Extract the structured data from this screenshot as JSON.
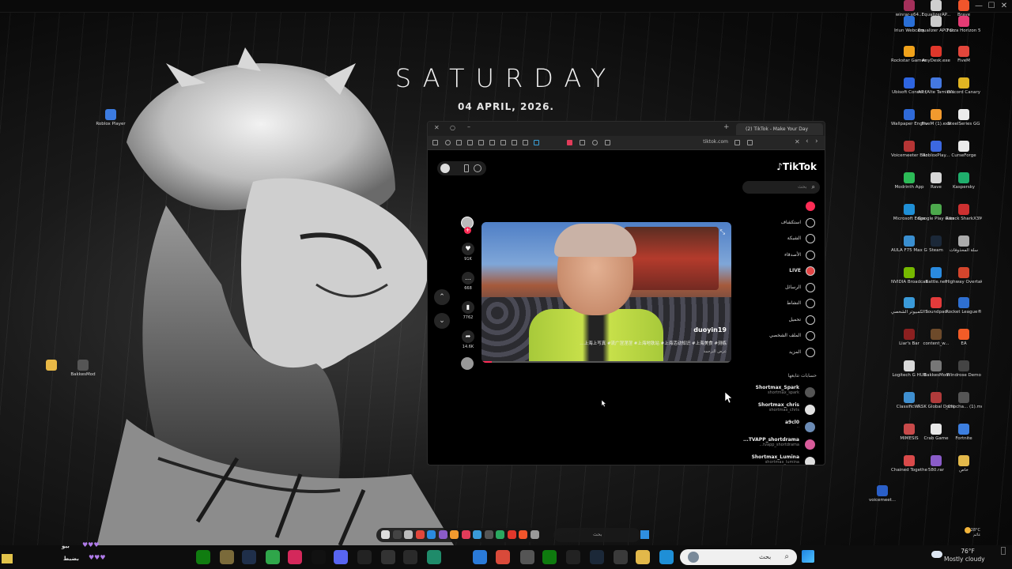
{
  "desktop": {
    "day": "SATURDAY",
    "date": "04 APRIL, 2026.",
    "left_icons": [
      {
        "label": "Roblox Player",
        "color": "#3c7be0"
      },
      {
        "label": "BakkesMod",
        "color": "#555555"
      }
    ],
    "right_icons": [
      {
        "label": "Iriun Webcam",
        "color": "#2a6fd6"
      },
      {
        "label": "Equalizer APO Confi...",
        "color": "#c9c9c9"
      },
      {
        "label": "Forza Horizon 5",
        "color": "#e53b74"
      },
      {
        "label": "Rockstar Games ...",
        "color": "#f0a21b"
      },
      {
        "label": "AnyDesk.exe",
        "color": "#e0372b"
      },
      {
        "label": "FiveM",
        "color": "#e2463b"
      },
      {
        "label": "Ubisoft Connect",
        "color": "#2e65e0"
      },
      {
        "label": "A7 (Alte Tamim’th...",
        "color": "#4478e0"
      },
      {
        "label": "Discord Canary",
        "color": "#e0b422"
      },
      {
        "label": "Wallpaper Engine",
        "color": "#2f6ad8"
      },
      {
        "label": "FiveM (1).exe",
        "color": "#f29a2e"
      },
      {
        "label": "SteelSeries GG",
        "color": "#ececec"
      },
      {
        "label": "Voicemeeter Banana",
        "color": "#b53535"
      },
      {
        "label": "RobloxPlay...",
        "color": "#3c68e0"
      },
      {
        "label": "CurseForge",
        "color": "#eaeaea"
      },
      {
        "label": "Modrinth App",
        "color": "#2cbb57"
      },
      {
        "label": "Rave",
        "color": "#d7d7d7"
      },
      {
        "label": "Kaspersky",
        "color": "#1fae6c"
      },
      {
        "label": "Microsoft Edge",
        "color": "#1f8fd6"
      },
      {
        "label": "Google Play Games",
        "color": "#4ca84c"
      },
      {
        "label": "Attack SharkX3M...",
        "color": "#cc3030"
      },
      {
        "label": "AULA F75 Max Gask...",
        "color": "#3a8fd0"
      },
      {
        "label": "Steam",
        "color": "#1b2838"
      },
      {
        "label": "سلة المحذوفات",
        "color": "#aaaaaa"
      },
      {
        "label": "NVIDIA Broadcast",
        "color": "#76b900"
      },
      {
        "label": "Battle.net",
        "color": "#2a8be0"
      },
      {
        "label": "Highway Overtake...",
        "color": "#d4452c"
      },
      {
        "label": "هذا الكمبيوتر الشخصي",
        "color": "#3a9ad9"
      },
      {
        "label": "Soundpad",
        "color": "#e23b3b"
      },
      {
        "label": "Rocket League®",
        "color": "#2e6fd1"
      },
      {
        "label": "Liar's Bar",
        "color": "#8c2020"
      },
      {
        "label": "content_w...",
        "color": "#6d4a2a"
      },
      {
        "label": "EA",
        "color": "#f25c27"
      },
      {
        "label": "Logitech G HUB",
        "color": "#d9d9d9"
      },
      {
        "label": "BakkesMod",
        "color": "#777777"
      },
      {
        "label": "Windrose Demo",
        "color": "#444444"
      },
      {
        "label": "ClassificW...",
        "color": "#3f8fd0"
      },
      {
        "label": "RSK Global Domination",
        "color": "#b03b3b"
      },
      {
        "label": "_Clipcha... (1).mov",
        "color": "#555555"
      },
      {
        "label": "MIMESIS",
        "color": "#c84a4a"
      },
      {
        "label": "Crab Game",
        "color": "#e8e8e8"
      },
      {
        "label": "Fortnite",
        "color": "#3d7fe0"
      },
      {
        "label": "Chained Together",
        "color": "#d94a4a"
      },
      {
        "label": "580.rar",
        "color": "#8a5cc9"
      },
      {
        "label": "خاص",
        "color": "#e2b84a"
      },
      {
        "label": "winrar-x64...",
        "color": "#a4305b"
      },
      {
        "label": "EqualizerAP...",
        "color": "#cfcfcf"
      },
      {
        "label": "Brave",
        "color": "#f0552b"
      },
      {
        "label": "voicemeet...",
        "color": "#2a5fc8"
      }
    ]
  },
  "browser": {
    "tab_title": "(2) TikTok - Make Your Day",
    "url": "tiktok.com"
  },
  "tiktok": {
    "logo": "TikTok",
    "search_placeholder": "بحث",
    "nav": [
      {
        "label": "",
        "icon": "home-icon"
      },
      {
        "label": "استكشاف",
        "icon": "compass-icon"
      },
      {
        "label": "الشبكة",
        "icon": "network-icon"
      },
      {
        "label": "الأصدقاء",
        "icon": "friends-icon"
      },
      {
        "label": "LIVE",
        "icon": "live-icon"
      },
      {
        "label": "الرسائل",
        "icon": "messages-icon"
      },
      {
        "label": "النشاط",
        "icon": "activity-icon"
      },
      {
        "label": "تحميل",
        "icon": "upload-icon"
      },
      {
        "label": "الملف الشخصي",
        "icon": "profile-icon"
      },
      {
        "label": "المزيد",
        "icon": "more-icon"
      }
    ],
    "following_header": "حسابات تتابعها",
    "following": [
      {
        "name": "Shortmax_Spark",
        "handle": "shortmax_spark",
        "color": "#555555"
      },
      {
        "name": "Shortmax_chris",
        "handle": "shortmax_chris",
        "color": "#e0e0e0"
      },
      {
        "name": "a9cl0",
        "handle": "··",
        "color": "#6b8bb5"
      },
      {
        "name": "...TVAPP_shortdrama",
        "handle": "...tvapp_shortdrama",
        "color": "#d85b9a"
      },
      {
        "name": "Shortmax_Lumina",
        "handle": "shortmax_lumina",
        "color": "#dddddd"
      }
    ],
    "video": {
      "username": "duoyin19",
      "caption": "…上海上写真 #流广涅涅涅 #上海地铁站 #上海活动知识 #上海美食 #测练",
      "translate": "عرض الترجمة"
    },
    "actions": [
      {
        "icon": "heart-icon",
        "count": "91K"
      },
      {
        "icon": "comment-icon",
        "count": "668"
      },
      {
        "icon": "bookmark-icon",
        "count": "7762"
      },
      {
        "icon": "share-icon",
        "count": "14.6K"
      }
    ]
  },
  "taskbar": {
    "search_placeholder": "بحث",
    "weather_temp": "76°F",
    "weather_desc": "Mostly cloudy",
    "mini_temp": "28°C",
    "mini_desc": "غائم",
    "status_name": "بضبط",
    "status_prefix": "بيو"
  }
}
